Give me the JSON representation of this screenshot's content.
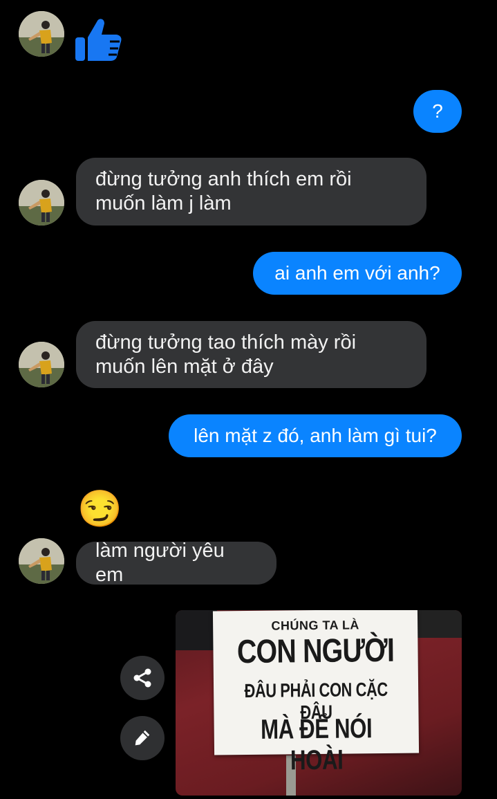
{
  "thread": {
    "icons": {
      "reaction": "thumbs-up-icon",
      "share": "share-icon",
      "edit": "pencil-icon"
    },
    "colors": {
      "outgoing_bubble": "#0a84ff",
      "incoming_bubble": "#333436",
      "background": "#000000",
      "like": "#1877f2"
    },
    "messages": [
      {
        "from": "contact",
        "type": "reaction",
        "value": "thumbs-up"
      },
      {
        "from": "me",
        "type": "text",
        "text": "?"
      },
      {
        "from": "contact",
        "type": "text",
        "line1": "đừng tưởng anh thích em rồi",
        "line2": "muốn làm j làm"
      },
      {
        "from": "me",
        "type": "text",
        "text": "ai anh em với anh?"
      },
      {
        "from": "contact",
        "type": "text",
        "line1": "đừng tưởng tao thích mày rồi",
        "line2": "muốn lên mặt ở đây"
      },
      {
        "from": "me",
        "type": "text",
        "text": "lên mặt z đó, anh làm gì tui?"
      },
      {
        "from": "contact",
        "type": "emoji",
        "text": "😏"
      },
      {
        "from": "contact",
        "type": "text",
        "text": "làm người yêu em"
      },
      {
        "from": "me",
        "type": "image",
        "sign_lines": [
          "CHÚNG TA LÀ",
          "CON NGƯỜI",
          "ĐÂU PHẢI CON CẶC ĐÂU",
          "MÀ ĐỂ NÓI HOÀI"
        ]
      }
    ]
  }
}
